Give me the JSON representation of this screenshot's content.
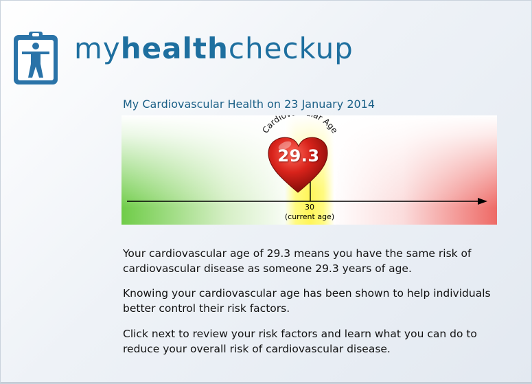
{
  "logo": {
    "text_part1": "my",
    "text_part2": "health",
    "text_part3": "checkup"
  },
  "page_title": "My Cardiovascular Health on 23 January 2014",
  "gauge": {
    "arc_label": "Cardiovascular Age",
    "cardiovascular_age": "29.3",
    "current_age": "30",
    "current_age_caption": "(current age)"
  },
  "paragraphs": {
    "p1": "Your cardiovascular age of 29.3 means you have the same risk of cardiovascular disease as someone 29.3 years of age.",
    "p2": "Knowing your cardiovascular age has been shown to help individuals better control their risk factors.",
    "p3": "Click next to review your risk factors and learn what you can do to reduce your overall risk of cardiovascular disease."
  },
  "colors": {
    "brand_blue": "#1e6f9f",
    "heart_red": "#cc1a14",
    "low_risk_green": "#6fcc48",
    "high_risk_red": "#ee6a66",
    "current_age_yellow": "#fff55a"
  },
  "icons": {
    "logo_icon": "person-clipboard-icon",
    "heart": "heart-icon"
  }
}
